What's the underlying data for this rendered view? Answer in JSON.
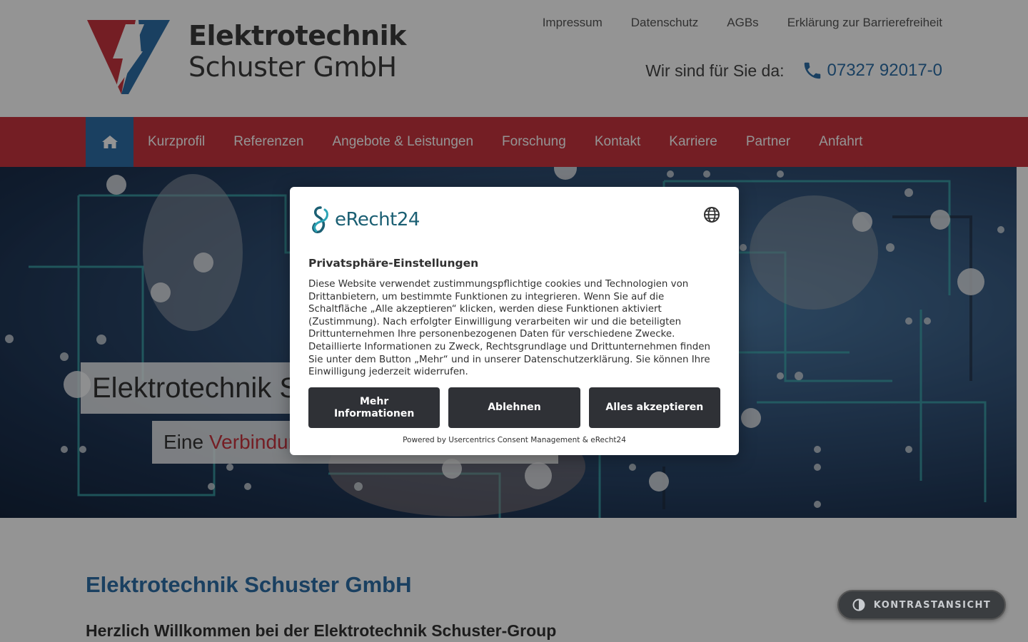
{
  "header": {
    "logo_line1": "Elektrotechnik",
    "logo_line2": "Schuster GmbH",
    "top_links": [
      "Impressum",
      "Datenschutz",
      "AGBs",
      "Erklärung zur Barrierefreiheit"
    ],
    "contact_label": "Wir sind für Sie da:",
    "phone": "07327 92017-0",
    "icons": {
      "phone": "phone-icon",
      "home": "home-icon"
    }
  },
  "nav": {
    "items": [
      "Kurzprofil",
      "Referenzen",
      "Angebote & Leistungen",
      "Forschung",
      "Kontakt",
      "Karriere",
      "Partner",
      "Anfahrt"
    ]
  },
  "hero": {
    "title": "Elektrotechnik Schuster GmbH",
    "subtitle_prefix": "Eine",
    "subtitle_accent": "Verbindung mit Zukunft"
  },
  "content": {
    "title": "Elektrotechnik Schuster GmbH",
    "subtitle": "Herzlich Willkommen bei der Elektrotechnik Schuster-Group"
  },
  "contrast": {
    "label": "KONTRASTANSICHT",
    "icon": "contrast-icon"
  },
  "consent": {
    "brand": "eRecht24",
    "heading": "Privatsphäre-Einstellungen",
    "body": "Diese Website verwendet zustimmungspflichtige cookies und Technologien von Drittanbietern, um bestimmte Funktionen zu integrieren. Wenn Sie auf die Schaltfläche „Alle akzeptieren“ klicken, werden diese Funktionen aktiviert (Zustimmung). Nach erfolgter Einwilligung verarbeiten wir und die beteiligten Drittunternehmen Ihre personenbezogenen Daten für verschiedene Zwecke. Detaillierte Informationen zu Zweck, Rechtsgrundlage und Drittunternehmen finden Sie unter dem Button „Mehr“ und in unserer Datenschutzerklärung. Sie können Ihre Einwilligung jederzeit widerrufen.",
    "buttons": {
      "more": "Mehr Informationen",
      "decline": "Ablehnen",
      "accept": "Alles akzeptieren"
    },
    "footer": "Powered by Usercentrics Consent Management & eRecht24",
    "icons": {
      "language": "globe-icon",
      "brand": "erecht24-logo-icon"
    }
  },
  "colors": {
    "brand_red": "#c9353f",
    "brand_blue": "#2e6fa7",
    "modal_button": "#2f3136",
    "erecht_teal": "#1b5f73"
  }
}
